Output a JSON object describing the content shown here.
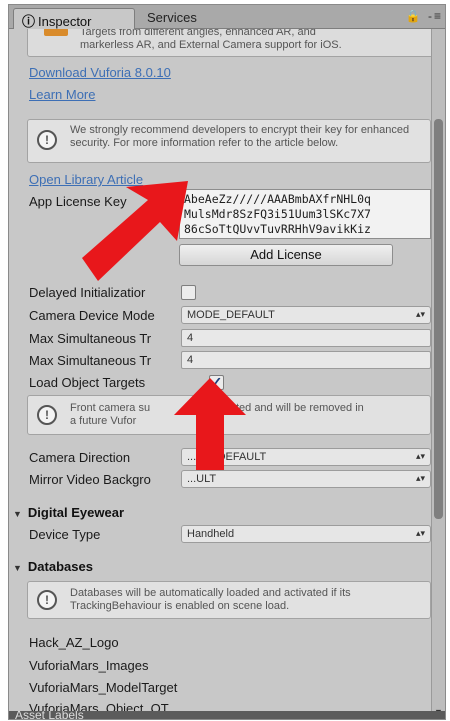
{
  "tabs": [
    {
      "label": "Inspector",
      "glyph": "ⓘ"
    },
    {
      "label": "Services"
    }
  ],
  "tab_tools": "🔒 -≡",
  "intro": {
    "text_lines": [
      "Targets from different angles, enhanced AR, and",
      "markerless AR, and External Camera support for iOS."
    ]
  },
  "links": {
    "download": "Download Vuforia 8.0.10",
    "learn_more": "Learn More",
    "open_library": "Open Library Article"
  },
  "security_help": "We strongly recommend developers to encrypt their key for enhanced security. For more information refer to the article below.",
  "license": {
    "label": "App License Key",
    "lines": [
      "AbeAeZz/////AAABmbAXfrNHL0q",
      "MulsMdr8SzFQ3i51Uum3lSKc7X7",
      "86cSoTtQUvvTuvRRHhV9avikKiz"
    ],
    "add_button": "Add License"
  },
  "fields": {
    "delayed_init": {
      "label": "Delayed Initializatior",
      "checked": false
    },
    "camera_device_mode": {
      "label": "Camera Device Mode",
      "value": "MODE_DEFAULT"
    },
    "max_sim_1": {
      "label": "Max Simultaneous Tr",
      "value": "4"
    },
    "max_sim_2": {
      "label": "Max Simultaneous Tr",
      "value": "4"
    },
    "load_object_targets": {
      "label": "Load Object Targets",
      "checked": true
    }
  },
  "front_camera_help": "Front camera su... deprecated and will be removed in a future Vufor...",
  "front_camera_help_lines": [
    "Front camera su",
    "deprecated and will be removed in",
    "a future Vufor"
  ],
  "camera": {
    "direction": {
      "label": "Camera Direction",
      "value": "...RA_DEFAULT"
    },
    "mirror": {
      "label": "Mirror Video Backgro",
      "value": "...ULT"
    }
  },
  "digital_eyewear": {
    "title": "Digital Eyewear",
    "device_type": {
      "label": "Device Type",
      "value": "Handheld"
    }
  },
  "databases": {
    "title": "Databases",
    "help": "Databases will be automatically loaded and activated if its TrackingBehaviour is enabled on scene load.",
    "items": [
      "Hack_AZ_Logo",
      "VuforiaMars_Images",
      "VuforiaMars_ModelTarget",
      "VuforiaMars_Object_OT"
    ]
  },
  "status_bar": "Asset Labels",
  "colors": {
    "arrow": "#e8171b",
    "link": "#3d6fb5",
    "panel": "#c8c8c8"
  }
}
